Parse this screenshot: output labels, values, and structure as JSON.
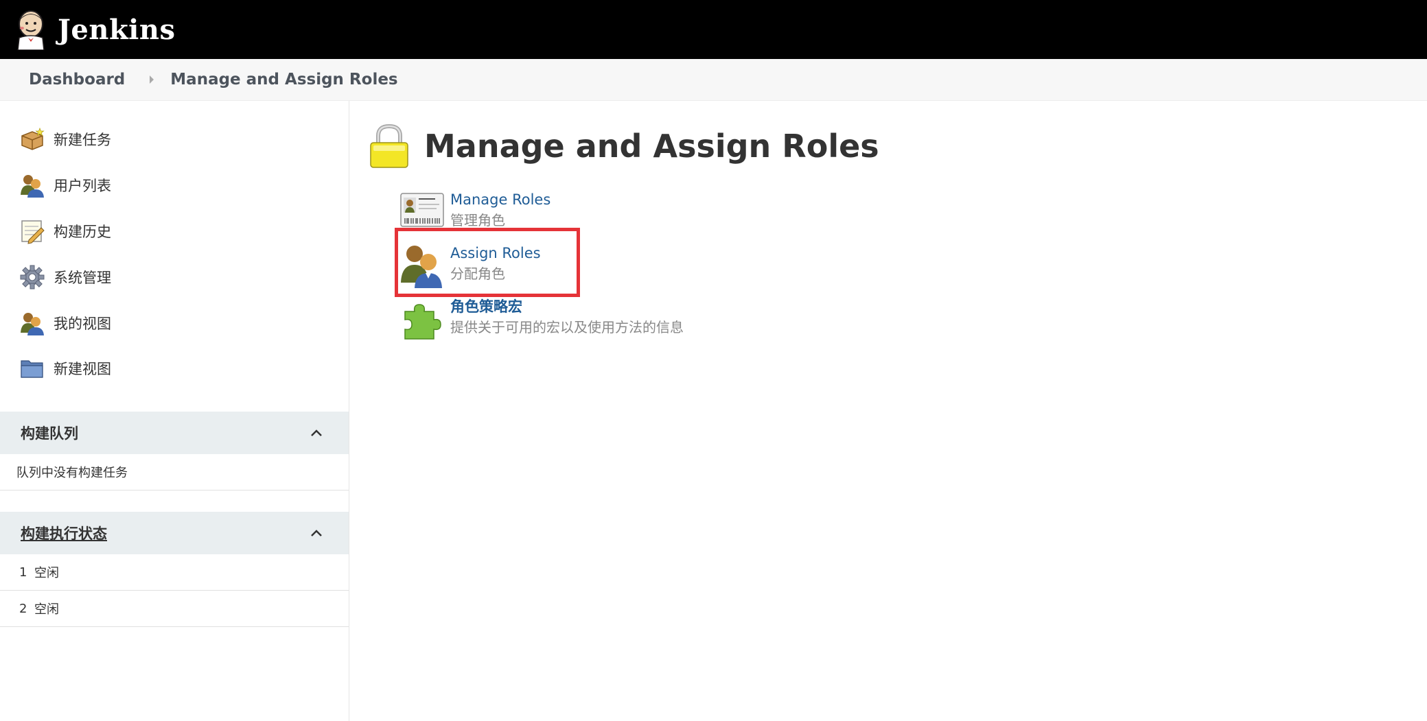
{
  "header": {
    "brand": "Jenkins"
  },
  "breadcrumbs": [
    "Dashboard",
    "Manage and Assign Roles"
  ],
  "sidebar": {
    "tasks": [
      {
        "label": "新建任务",
        "icon": "package-icon"
      },
      {
        "label": "用户列表",
        "icon": "users-icon"
      },
      {
        "label": "构建历史",
        "icon": "notepad-icon"
      },
      {
        "label": "系统管理",
        "icon": "gear-icon"
      },
      {
        "label": "我的视图",
        "icon": "users-icon"
      },
      {
        "label": "新建视图",
        "icon": "folder-icon"
      }
    ],
    "build_queue": {
      "title": "构建队列",
      "empty_message": "队列中没有构建任务"
    },
    "executors": {
      "title": "构建执行状态",
      "items": [
        {
          "num": "1",
          "status": "空闲"
        },
        {
          "num": "2",
          "status": "空闲"
        }
      ]
    }
  },
  "main": {
    "title": "Manage and Assign Roles",
    "items": [
      {
        "link": "Manage Roles",
        "desc": "管理角色",
        "icon": "id-card-icon"
      },
      {
        "link": "Assign Roles",
        "desc": "分配角色",
        "icon": "users-icon"
      },
      {
        "link": "角色策略宏",
        "desc": "提供关于可用的宏以及使用方法的信息",
        "icon": "puzzle-icon"
      }
    ]
  },
  "colors": {
    "topbar": "#000000",
    "link": "#1f5c96",
    "highlight": "#e53338",
    "pane_header": "#e9eef0"
  }
}
